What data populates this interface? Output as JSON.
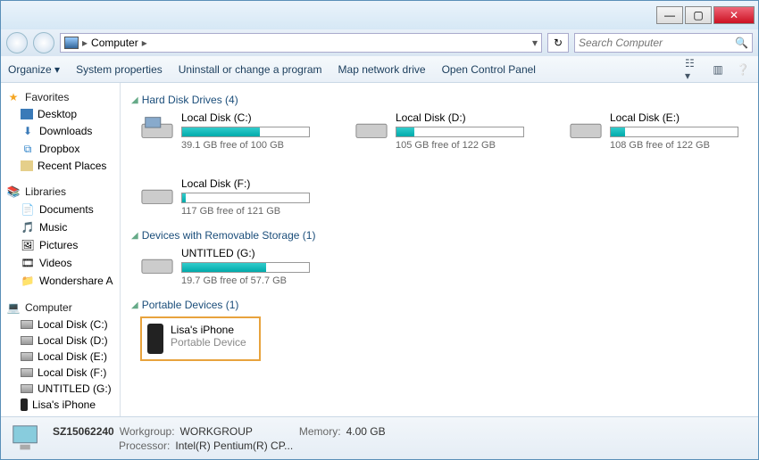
{
  "titlebar": {},
  "address": {
    "location": "Computer",
    "arrow": "▶"
  },
  "search": {
    "placeholder": "Search Computer"
  },
  "toolbar": {
    "organize": "Organize ▾",
    "sysprops": "System properties",
    "uninstall": "Uninstall or change a program",
    "mapnet": "Map network drive",
    "opencp": "Open Control Panel"
  },
  "sidebar": {
    "favorites": {
      "label": "Favorites",
      "items": [
        "Desktop",
        "Downloads",
        "Dropbox",
        "Recent Places"
      ]
    },
    "libraries": {
      "label": "Libraries",
      "items": [
        "Documents",
        "Music",
        "Pictures",
        "Videos",
        "Wondershare A"
      ]
    },
    "computer": {
      "label": "Computer",
      "items": [
        "Local Disk (C:)",
        "Local Disk (D:)",
        "Local Disk (E:)",
        "Local Disk (F:)",
        "UNTITLED (G:)",
        "Lisa's iPhone"
      ]
    }
  },
  "sections": {
    "hdd": {
      "label": "Hard Disk Drives (4)"
    },
    "removable": {
      "label": "Devices with Removable Storage (1)"
    },
    "portable": {
      "label": "Portable Devices (1)"
    }
  },
  "drives": {
    "c": {
      "name": "Local Disk (C:)",
      "free": "39.1 GB free of 100 GB",
      "pct": 61
    },
    "d": {
      "name": "Local Disk (D:)",
      "free": "105 GB free of 122 GB",
      "pct": 14
    },
    "e": {
      "name": "Local Disk (E:)",
      "free": "108 GB free of 122 GB",
      "pct": 11
    },
    "f": {
      "name": "Local Disk (F:)",
      "free": "117 GB free of 121 GB",
      "pct": 3
    },
    "g": {
      "name": "UNTITLED (G:)",
      "free": "19.7 GB free of 57.7 GB",
      "pct": 66
    }
  },
  "portable_device": {
    "name": "Lisa's iPhone",
    "type": "Portable Device"
  },
  "status": {
    "computer_name": "SZ15062240",
    "workgroup_label": "Workgroup:",
    "workgroup": "WORKGROUP",
    "memory_label": "Memory:",
    "memory": "4.00 GB",
    "processor_label": "Processor:",
    "processor": "Intel(R) Pentium(R) CP..."
  }
}
